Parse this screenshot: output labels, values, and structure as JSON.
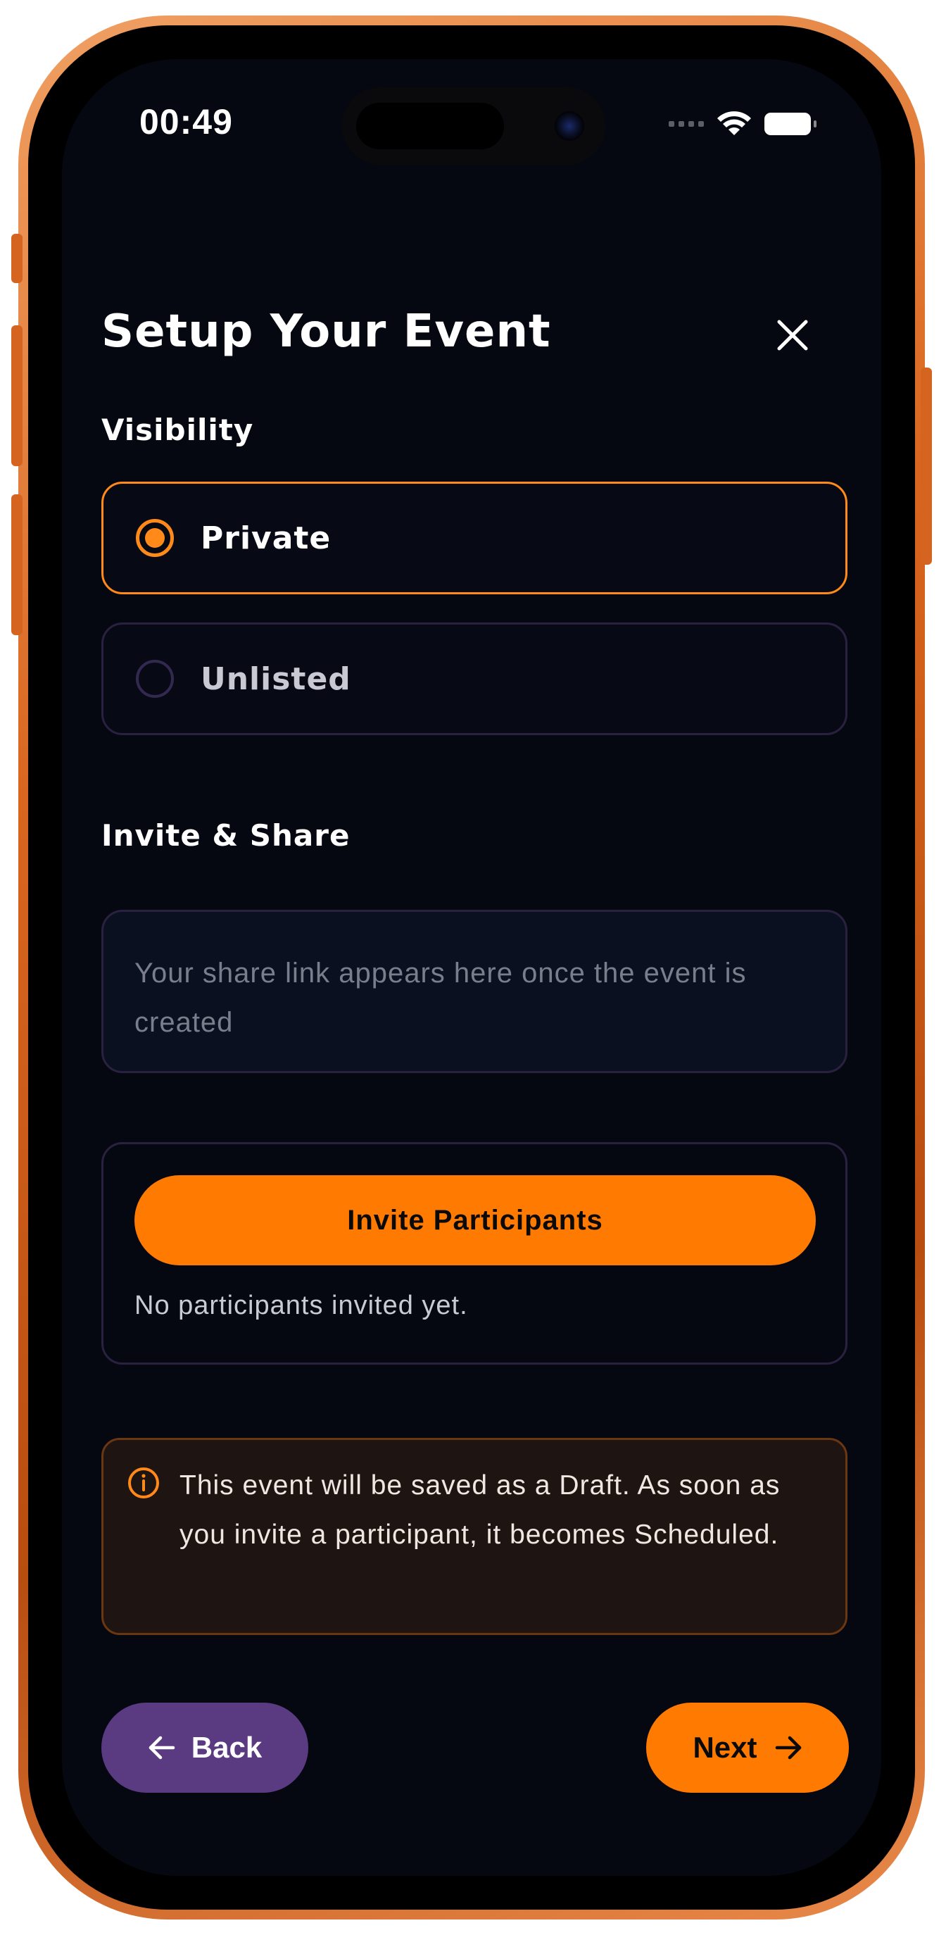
{
  "status_bar": {
    "time": "00:49"
  },
  "header": {
    "title": "Setup Your Event",
    "close_icon": "close-icon"
  },
  "visibility": {
    "label": "Visibility",
    "options": [
      {
        "label": "Private",
        "selected": true
      },
      {
        "label": "Unlisted",
        "selected": false
      }
    ]
  },
  "invite_share": {
    "label": "Invite & Share",
    "share_link_placeholder": "Your share link appears here once the event is created"
  },
  "participants": {
    "invite_button_label": "Invite Participants",
    "status_text": "No participants invited yet."
  },
  "notice": {
    "icon": "info-icon",
    "text": "This event will be saved as a Draft. As soon as you invite a participant, it becomes Scheduled."
  },
  "footer": {
    "back_label": "Back",
    "next_label": "Next"
  },
  "colors": {
    "accent": "#ff7a00",
    "background": "#050811",
    "back_button": "#5a3a80",
    "card_border": "#2a2140"
  }
}
